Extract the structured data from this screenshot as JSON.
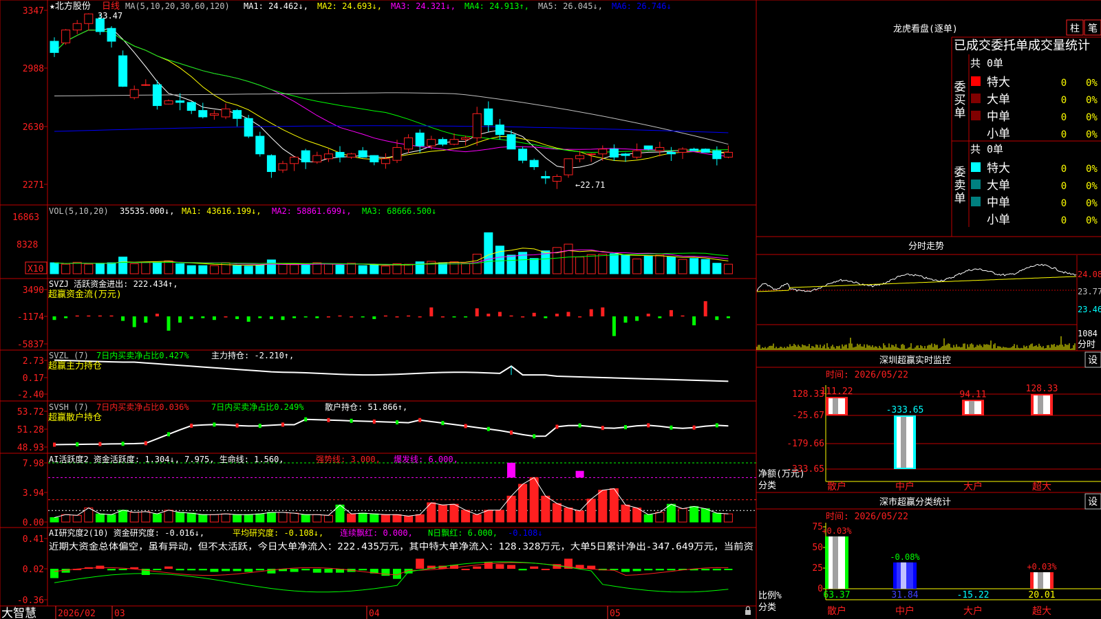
{
  "colors": {
    "up": "#ff2020",
    "down": "#00ffff",
    "grid": "#c00000",
    "ma1": "#ffffff",
    "ma2": "#ffff00",
    "ma3": "#ff00ff",
    "ma4": "#00ff00",
    "ma5": "#c0c0c0",
    "ma6": "#0000ff",
    "white": "#ffffff",
    "yellow": "#ffff00",
    "green": "#00ff00",
    "magenta": "#ff00ff",
    "cyan": "#00ffff",
    "gray": "#c0c0c0"
  },
  "main": {
    "title": "★北方股份",
    "period": "日线",
    "ma_label": "MA(5,10,20,30,60,120)",
    "ma_values": [
      "MA1: 24.462↓,",
      "MA2: 24.693↓,",
      "MA3: 24.321↓,",
      "MA4: 24.913↑,",
      "MA5: 26.045↓,",
      "MA6: 26.746↓"
    ],
    "yticks": [
      "3347",
      "2988",
      "2630",
      "2271"
    ],
    "high_mark": "33.47",
    "low_mark": "←22.71"
  },
  "vol": {
    "label": "VOL(5,10,20)",
    "values": [
      "35535.000↓,",
      "MA1: 43616.199↓,",
      "MA2: 58861.699↓,",
      "MA3: 68666.500↓"
    ],
    "yticks": [
      "16863",
      "8328"
    ],
    "unit": "X10"
  },
  "svzj": {
    "label": "SVZJ  活跃资金进出: 222.434↑,",
    "sub": "超赢资金流(万元)",
    "yticks": [
      "3490",
      "-1174",
      "-5837"
    ]
  },
  "svzl": {
    "label1": "SVZL (7)",
    "label2": "7日内买卖净占比0.427%",
    "label3": "主力持仓: -2.210↑,",
    "sub": "超赢主力持仓",
    "yticks": [
      "2.73",
      "0.17",
      "-2.40"
    ]
  },
  "svsh": {
    "label1": "SVSH (7)",
    "label2": "7日内买卖净占比0.036%",
    "label3": "7日内买卖净占比0.249%",
    "label4": "散户持仓: 51.866↑,",
    "sub": "超赢散户持仓",
    "yticks": [
      "53.72",
      "51.28",
      "48.93"
    ]
  },
  "ai1": {
    "label": "AI活跃度2 资金活跃度: 1.304↓, 7.975, 生命线: 1.560,",
    "strong": "强势线: 3.000,",
    "burst": "爆发线: 6.000,",
    "yticks": [
      "7.98",
      "3.94",
      "0.00"
    ]
  },
  "ai2": {
    "label": "AI研究度2(10) 资金研究度: -0.016↓,",
    "avg": "平均研究度: -0.108↓,",
    "red": "连续飘红: 0.000,",
    "nred": "N日飘红: 6.000,",
    "last": "-0.108↓",
    "desc": "近期大资金总体偏空，虽有异动，但不太活跃，今日大单净流入：222.435万元，其中特大单净流入：128.328万元，大单5日累计净出-347.649万元，当前资",
    "yticks": [
      "0.41",
      "0.02",
      "-0.36"
    ]
  },
  "xaxis": {
    "labels": [
      "2026/02",
      "03",
      "04",
      "05"
    ]
  },
  "bottom_left": "大智慧",
  "rp": {
    "title": "龙虎看盘(逐单)",
    "btn1": "柱",
    "btn2": "笔",
    "tab": "已成交委托单成交量统计",
    "buy_label": "委买单",
    "sell_label": "委卖单",
    "buy_total": "共 0单",
    "sell_total": "共 0单",
    "rows": [
      {
        "name": "特大",
        "count": "0",
        "pct": "0%"
      },
      {
        "name": "大单",
        "count": "0",
        "pct": "0%"
      },
      {
        "name": "中单",
        "count": "0",
        "pct": "0%"
      },
      {
        "name": "小单",
        "count": "0",
        "pct": "0%"
      }
    ],
    "buy_colors": [
      "#ff0000",
      "#800000",
      "#800000",
      ""
    ],
    "sell_colors": [
      "#00ffff",
      "#008080",
      "#008080",
      ""
    ]
  },
  "intraday": {
    "title": "分时走势",
    "yticks": [
      "24.08",
      "23.77",
      "23.46"
    ],
    "vol_top": "1084",
    "vol_unit": "分时"
  },
  "sz": {
    "title": "深圳超赢实时监控",
    "set": "设",
    "time": "时间: 2026/05/22",
    "yticks": [
      "128.33",
      "-25.67",
      "-179.66",
      "-333.65"
    ],
    "unit1": "净额(万元)",
    "unit2": "分类",
    "cats": [
      "散户",
      "中户",
      "大户",
      "超大"
    ],
    "bar_values": [
      111.22,
      -333.65,
      94.11,
      128.33
    ],
    "bar_labels": [
      "111.22",
      "-333.65",
      "94.11",
      "128.33"
    ]
  },
  "scls": {
    "title": "深市超赢分类统计",
    "set": "设",
    "time": "时间: 2026/05/22",
    "yticks": [
      "75",
      "50",
      "25",
      "0"
    ],
    "unit1": "比例%",
    "unit2": "分类",
    "cats": [
      "散户",
      "中户",
      "大户",
      "超大"
    ],
    "bar_values": [
      63.37,
      31.84,
      0,
      20.01
    ],
    "bar_pcts": [
      "+0.03%",
      "-0.08%",
      "",
      "+0.03%"
    ],
    "bottom_values": [
      "63.37",
      "31.84",
      "-15.22",
      "20.01"
    ]
  }
}
